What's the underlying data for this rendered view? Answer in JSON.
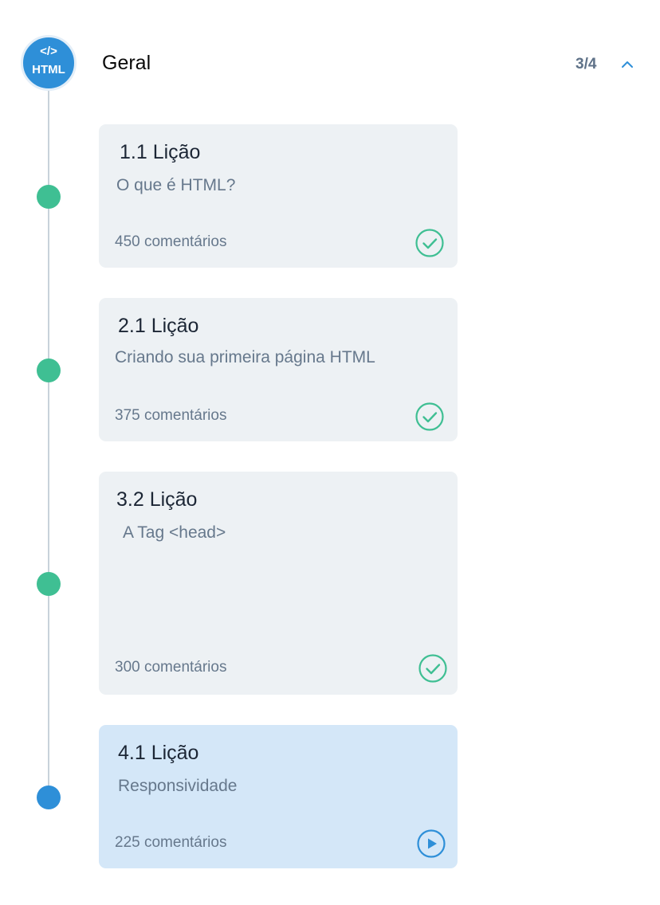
{
  "section": {
    "badge_code": "</>",
    "badge_text": "HTML",
    "title": "Geral",
    "progress": "3/4",
    "toggle_icon": "chevron-up-icon"
  },
  "colors": {
    "accent_blue": "#2e8fd8",
    "done_green": "#3fbf93",
    "card_default": "#edf1f4",
    "card_current": "#d4e7f8",
    "timeline": "#c8d2da"
  },
  "lessons": [
    {
      "title": "1.1 Lição",
      "subtitle": "O que é HTML?",
      "comments": "450 comentários",
      "status": "completed",
      "status_icon": "check-circle-icon"
    },
    {
      "title": "2.1 Lição",
      "subtitle": "Criando sua primeira página HTML",
      "comments": "375 comentários",
      "status": "completed",
      "status_icon": "check-circle-icon"
    },
    {
      "title": "3.2 Lição",
      "subtitle": "A Tag <head>",
      "comments": "300 comentários",
      "status": "completed",
      "status_icon": "check-circle-icon"
    },
    {
      "title": "4.1 Lição",
      "subtitle": "Responsividade",
      "comments": "225 comentários",
      "status": "current",
      "status_icon": "play-circle-icon"
    }
  ]
}
